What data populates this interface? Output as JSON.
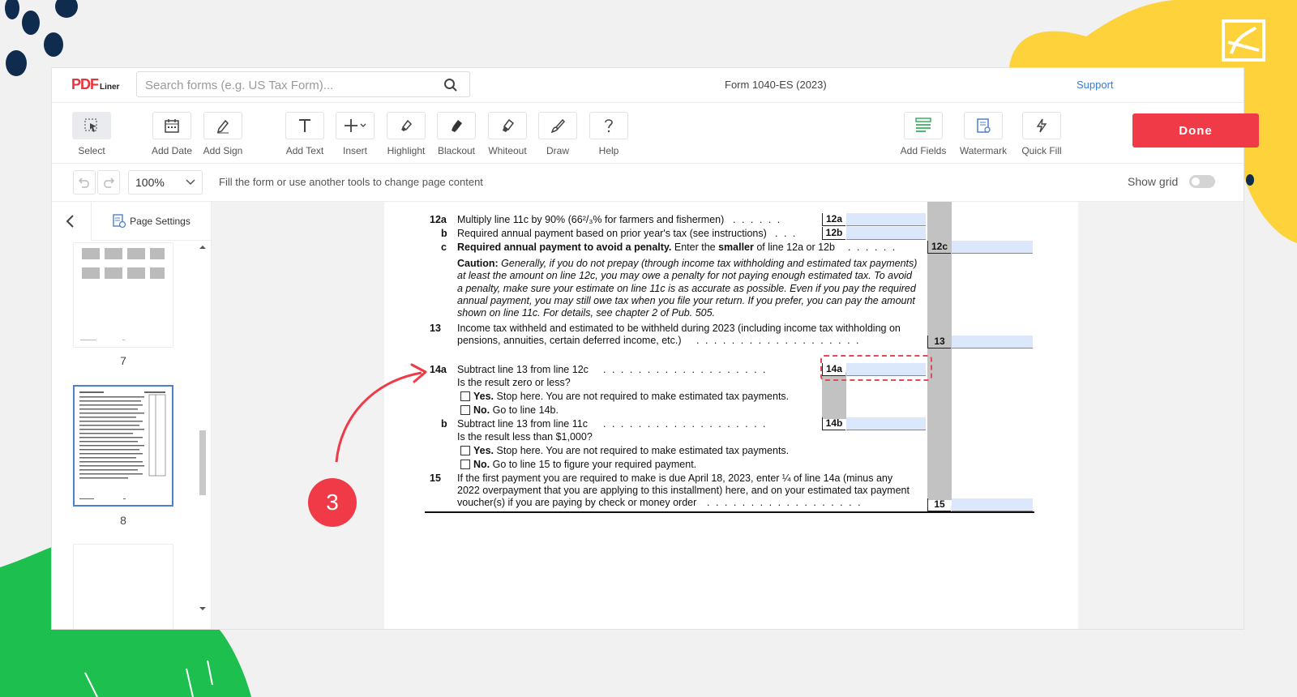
{
  "header": {
    "logo_main": "PDF",
    "logo_sub": "Liner",
    "search_placeholder": "Search forms (e.g. US Tax Form)...",
    "document_title": "Form 1040-ES (2023)",
    "support_link": "Support"
  },
  "toolbar": {
    "select": "Select",
    "add_date": "Add Date",
    "add_sign": "Add Sign",
    "add_text": "Add Text",
    "insert": "Insert",
    "highlight": "Highlight",
    "blackout": "Blackout",
    "whiteout": "Whiteout",
    "draw": "Draw",
    "help": "Help",
    "add_fields": "Add Fields",
    "watermark": "Watermark",
    "quick_fill": "Quick Fill",
    "done": "Done"
  },
  "subbar": {
    "zoom": "100%",
    "hint": "Fill the form or use another tools to change page content",
    "show_grid": "Show grid"
  },
  "sidebar": {
    "page_settings": "Page Settings",
    "pages": [
      "7",
      "8"
    ]
  },
  "form": {
    "l12a_num": "12a",
    "l12a_text": "Multiply line 11c by 90% (66²/₃% for farmers and fishermen)",
    "l12a_box": "12a",
    "l12b_num": "b",
    "l12b_text": "Required annual payment based on prior year's tax (see instructions)",
    "l12b_box": "12b",
    "l12c_num": "c",
    "l12c_bold": "Required annual payment to avoid a penalty.",
    "l12c_text": " Enter the ",
    "l12c_bold2": "smaller",
    "l12c_text2": " of line 12a or 12b",
    "l12c_box": "12c",
    "caution_label": "Caution:",
    "caution_1": " Generally, if you do not prepay (through income tax withholding and estimated tax payments)",
    "caution_2": "at least the amount on line 12c, you may owe a penalty for not paying enough estimated tax. To avoid",
    "caution_3": "a penalty, make sure your estimate on line 11c is as accurate as possible. Even if you pay the required",
    "caution_4": "annual payment, you may still owe tax when you file your return. If you prefer, you can pay the amount",
    "caution_5": "shown on line 11c. For details, see chapter 2 of Pub. 505.",
    "l13_num": "13",
    "l13_text1": "Income tax withheld and estimated to be withheld during 2023 (including income tax withholding on",
    "l13_text2": "pensions, annuities, certain deferred income, etc.)",
    "l13_box": "13",
    "l14a_num": "14a",
    "l14a_text": "Subtract line 13 from line 12c",
    "l14a_box": "14a",
    "l14a_q": "Is the result zero or less?",
    "l14a_yes": "Yes.",
    "l14a_yes_text": " Stop here. You are not required to make estimated tax payments.",
    "l14a_no": "No.",
    "l14a_no_text": " Go to line 14b.",
    "l14b_num": "b",
    "l14b_text": "Subtract line 13 from line 11c",
    "l14b_box": "14b",
    "l14b_q": "Is the result less than $1,000?",
    "l14b_yes": "Yes.",
    "l14b_yes_text": " Stop here. You are not required to make estimated tax payments.",
    "l14b_no": "No.",
    "l14b_no_text": " Go to line 15 to figure your required payment.",
    "l15_num": "15",
    "l15_text1": "If the first payment you are required to make is due April 18, 2023, enter ¼ of line 14a (minus any",
    "l15_text2": "2022 overpayment that you are applying to this installment) here, and on your estimated tax payment",
    "l15_text3": "voucher(s) if you are paying by check or money order",
    "l15_box": "15",
    "dots": ". . . . . . . . . . . . . . . . . . . . . . . . ."
  },
  "step_badge": "3",
  "colors": {
    "brand_red": "#f03a47",
    "field_blue": "#dbe8fb",
    "deco_yellow": "#fdd23a",
    "deco_green": "#1dbf4e",
    "deco_navy": "#0f2b4d"
  }
}
